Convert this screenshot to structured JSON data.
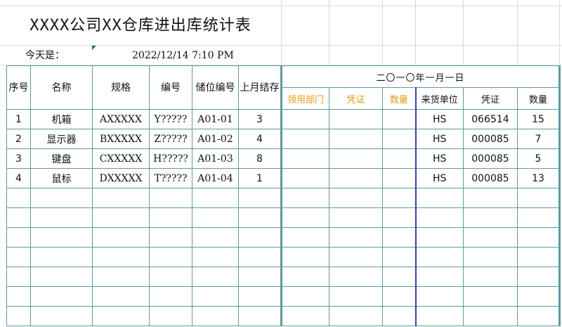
{
  "sheet": {
    "title": "XXXX公司XX仓库进出库统计表",
    "today_label": "今天是：",
    "today_value": "2022/12/14 7:10 PM"
  },
  "table": {
    "headers": {
      "seq": "序号",
      "name": "名称",
      "spec": "规格",
      "code": "编号",
      "storage": "储位编号",
      "last_month": "上月结存",
      "date": "二〇一〇年一月一日",
      "out_dept": "领用部门",
      "out_voucher": "凭证",
      "out_qty": "数量",
      "in_supplier": "来货单位",
      "in_voucher": "凭证",
      "in_qty": "数量"
    },
    "rows": [
      {
        "seq": "1",
        "name": "机箱",
        "spec": "AXXXXX",
        "code": "Y?????",
        "storage": "A01-01",
        "last": "3",
        "supplier": "HS",
        "voucher": "066514",
        "qty": "15"
      },
      {
        "seq": "2",
        "name": "显示器",
        "spec": "BXXXXX",
        "code": "Z?????",
        "storage": "A01-02",
        "last": "4",
        "supplier": "HS",
        "voucher": "000085",
        "qty": "7"
      },
      {
        "seq": "3",
        "name": "键盘",
        "spec": "CXXXXX",
        "code": "H?????",
        "storage": "A01-03",
        "last": "8",
        "supplier": "HS",
        "voucher": "000085",
        "qty": "5"
      },
      {
        "seq": "4",
        "name": "鼠标",
        "spec": "DXXXXX",
        "code": "T?????",
        "storage": "A01-04",
        "last": "1",
        "supplier": "HS",
        "voucher": "000085",
        "qty": "13"
      }
    ]
  },
  "colors": {
    "grid": "#5e9b9c",
    "orange_header": "#e69b12",
    "blue_divider": "#3b3fa8",
    "cell_marker": "#1e7145"
  }
}
